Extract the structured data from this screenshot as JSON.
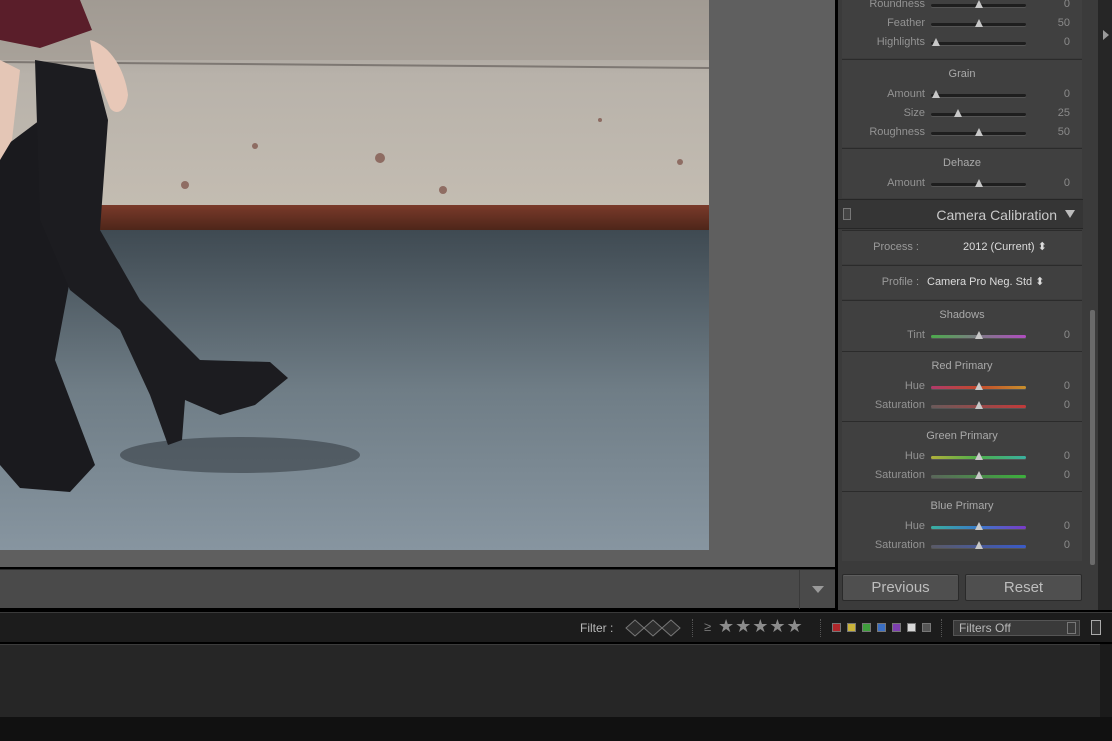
{
  "colors": {
    "panel_bg": "#3b3b3b",
    "section_bg": "#404040",
    "canvas_bg": "#5f5f5f",
    "filter_red": "#b0272b",
    "filter_yellow": "#c9b33a",
    "filter_green": "#3f9d3c",
    "filter_blue": "#3b6fc4",
    "filter_purple": "#7d3fb0"
  },
  "top_section": {
    "rows": [
      {
        "label": "Roundness",
        "value": "0",
        "position": 0.5
      },
      {
        "label": "Feather",
        "value": "50",
        "position": 0.5
      },
      {
        "label": "Highlights",
        "value": "0",
        "position": 0.05
      }
    ]
  },
  "grain": {
    "title": "Grain",
    "rows": [
      {
        "label": "Amount",
        "value": "0",
        "position": 0.05
      },
      {
        "label": "Size",
        "value": "25",
        "position": 0.28
      },
      {
        "label": "Roughness",
        "value": "50",
        "position": 0.5
      }
    ]
  },
  "dehaze": {
    "title": "Dehaze",
    "rows": [
      {
        "label": "Amount",
        "value": "0",
        "position": 0.5
      }
    ]
  },
  "camera_calibration": {
    "title": "Camera Calibration",
    "process_label": "Process :",
    "process_value": "2012 (Current) ⬍",
    "profile_label": "Profile :",
    "profile_value": "Camera Pro Neg. Std ⬍",
    "shadows": {
      "title": "Shadows",
      "rows": [
        {
          "label": "Tint",
          "value": "0",
          "position": 0.5,
          "gradient": [
            "#4caa4c",
            "#b04cc0"
          ]
        }
      ]
    },
    "red_primary": {
      "title": "Red Primary",
      "rows": [
        {
          "label": "Hue",
          "value": "0",
          "position": 0.5,
          "gradient": [
            "#b03a6a",
            "#c24a2c",
            "#c8902c"
          ]
        },
        {
          "label": "Saturation",
          "value": "0",
          "position": 0.5,
          "gradient": [
            "#6a5a5a",
            "#c23a3a"
          ]
        }
      ]
    },
    "green_primary": {
      "title": "Green Primary",
      "rows": [
        {
          "label": "Hue",
          "value": "0",
          "position": 0.5,
          "gradient": [
            "#b0b03a",
            "#4cb04c",
            "#3ab0a0"
          ]
        },
        {
          "label": "Saturation",
          "value": "0",
          "position": 0.5,
          "gradient": [
            "#5a665a",
            "#3cb03c"
          ]
        }
      ]
    },
    "blue_primary": {
      "title": "Blue Primary",
      "rows": [
        {
          "label": "Hue",
          "value": "0",
          "position": 0.5,
          "gradient": [
            "#3ab0a0",
            "#3a7ac8",
            "#7a3ac8"
          ]
        },
        {
          "label": "Saturation",
          "value": "0",
          "position": 0.5,
          "gradient": [
            "#5a5a66",
            "#3a5ac8"
          ]
        }
      ]
    }
  },
  "buttons": {
    "previous": "Previous",
    "reset": "Reset"
  },
  "filter_bar": {
    "label": "Filter :",
    "ge": "≥",
    "stars": "★★★★★",
    "filters_value": "Filters Off"
  }
}
